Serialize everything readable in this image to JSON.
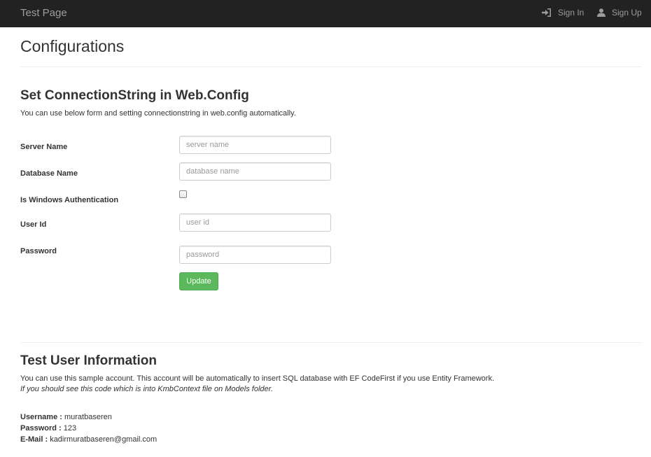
{
  "navbar": {
    "brand": "Test Page",
    "sign_in": "Sign In",
    "sign_up": "Sign Up",
    "sign_in_icon": "log-in-icon",
    "sign_up_icon": "user-icon"
  },
  "page": {
    "title": "Configurations"
  },
  "config_section": {
    "title": "Set ConnectionString in Web.Config",
    "description": "You can use below form and setting connectionstring in web.config automatically.",
    "fields": {
      "server_name": {
        "label": "Server Name",
        "placeholder": "server name",
        "value": ""
      },
      "database_name": {
        "label": "Database Name",
        "placeholder": "database name",
        "value": ""
      },
      "windows_auth": {
        "label": "Is Windows Authentication",
        "checked": false
      },
      "user_id": {
        "label": "User Id",
        "placeholder": "user id",
        "value": ""
      },
      "password": {
        "label": "Password",
        "placeholder": "password",
        "value": ""
      }
    },
    "update_label": "Update",
    "update_color": "#5cb85c"
  },
  "test_user_section": {
    "title": "Test User Information",
    "description": "You can use this sample account. This account will be automatically to insert SQL database with EF CodeFirst if you use Entity Framework.",
    "note": "If you should see this code which is into KmbContext file on Models folder.",
    "username_label": "Username :",
    "username_value": "muratbaseren",
    "password_label": "Password :",
    "password_value": "123",
    "email_label": "E-Mail :",
    "email_value": "kadirmuratbaseren@gmail.com"
  }
}
